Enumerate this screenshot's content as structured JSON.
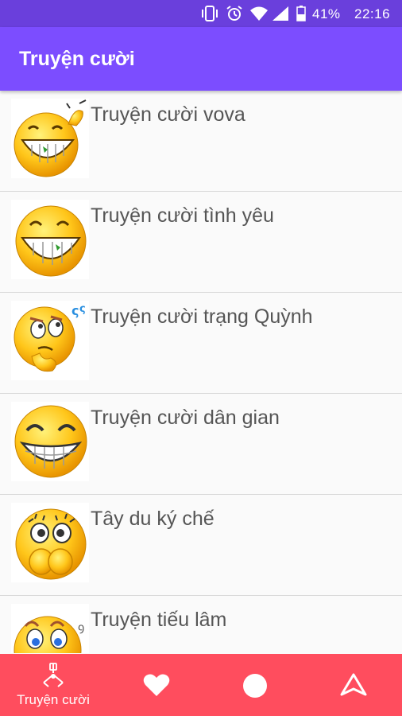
{
  "status_bar": {
    "battery": "41%",
    "time": "22:16",
    "icons": [
      "vibrate-icon",
      "alarm-icon",
      "wifi-icon",
      "signal-icon",
      "battery-icon"
    ]
  },
  "app_bar": {
    "title": "Truyện cười"
  },
  "list": {
    "items": [
      {
        "label": "Truyện cười vova",
        "icon": "smiley-thumbs-up-icon"
      },
      {
        "label": "Truyện cười tình yêu",
        "icon": "smiley-grin-icon"
      },
      {
        "label": "Truyện cười trạng Quỳnh",
        "icon": "smiley-thinking-icon"
      },
      {
        "label": "Truyện cười dân gian",
        "icon": "smiley-laughing-icon"
      },
      {
        "label": "Tây du ký chế",
        "icon": "smiley-shy-icon"
      },
      {
        "label": "Truyện tiếu lâm",
        "icon": "smiley-peek-icon"
      }
    ]
  },
  "bottom_nav": {
    "items": [
      {
        "label": "Truyện cười",
        "icon": "joke-book-icon",
        "active": true
      },
      {
        "label": "",
        "icon": "heart-icon"
      },
      {
        "label": "",
        "icon": "circle-icon"
      },
      {
        "label": "",
        "icon": "up-arrow-icon"
      }
    ]
  },
  "colors": {
    "status_bar": "#6a3fdc",
    "app_bar": "#7c4dff",
    "bottom_nav": "#ff4d5e",
    "list_bg": "#fafafa",
    "label_text": "#555555"
  }
}
